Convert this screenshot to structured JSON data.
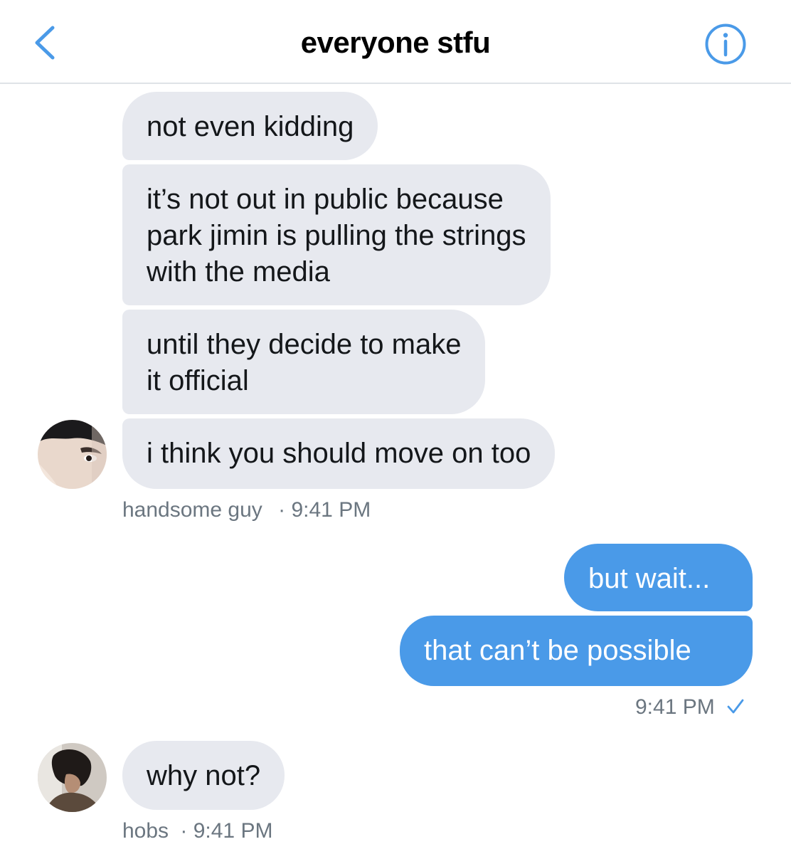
{
  "header": {
    "title": "everyone stfu",
    "back_icon": "chevron-left-icon",
    "info_icon": "info-circle-icon",
    "accent": "#4a9ae8"
  },
  "messages": {
    "group1": {
      "bubbles": [
        "not even kidding",
        "it’s not out in public because\npark jimin is pulling the strings\nwith the media",
        "until they decide to make\nit official",
        "i think you should move on too"
      ],
      "sender": "handsome guy",
      "time": "· 9:41 PM"
    },
    "group2": {
      "bubbles": [
        "but wait...",
        "that can’t be possible"
      ],
      "time": "9:41 PM",
      "status_icon": "check-icon"
    },
    "group3": {
      "bubbles": [
        "why not?"
      ],
      "sender": "hobs",
      "time": "· 9:41 PM"
    }
  },
  "colors": {
    "incoming_bubble": "#e7e9ef",
    "outgoing_bubble": "#4a9ae8",
    "meta_text": "#6b7680"
  }
}
